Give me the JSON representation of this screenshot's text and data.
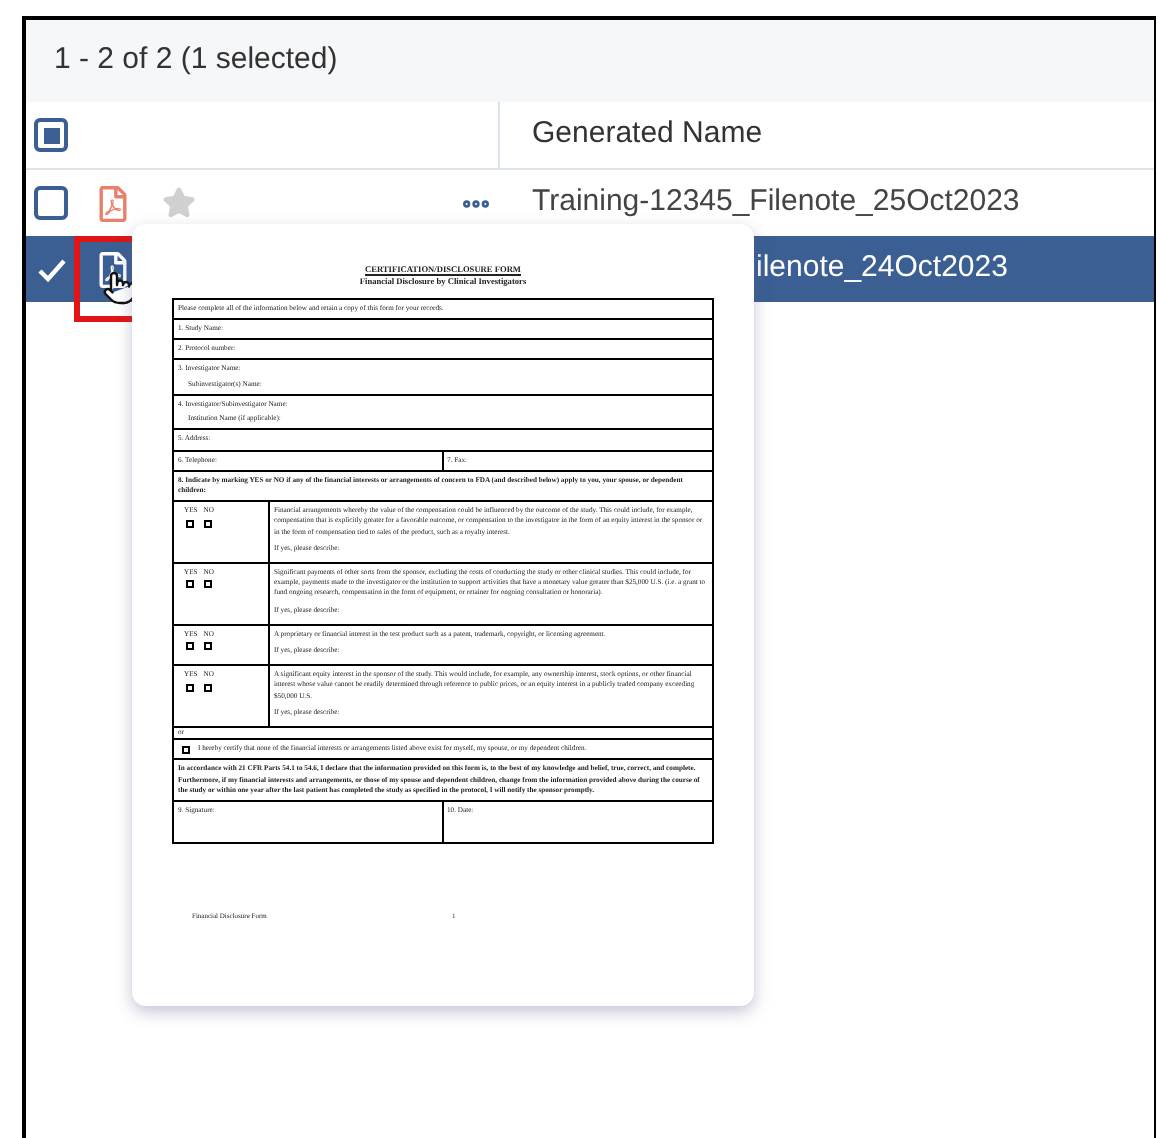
{
  "toolbar": {
    "count": "1 - 2 of 2 (1 selected)"
  },
  "table": {
    "header_checkbox": {
      "indeterminate": true
    },
    "columns": [
      "Generated Name"
    ],
    "rows": [
      {
        "selected": false,
        "checked": false,
        "starred": false,
        "hovered": false,
        "name": "Training-12345_Filenote_25Oct2023"
      },
      {
        "selected": true,
        "checked": true,
        "hovered": true,
        "name": "ilenote_24Oct2023"
      }
    ]
  },
  "preview": {
    "title": "CERTIFICATION/DISCLOSURE FORM",
    "subtitle": "Financial Disclosure by Clinical Investigators",
    "sections": [
      {
        "kind": "text",
        "texts": [
          "Please complete all of the information below and retain a copy of this form for your records."
        ]
      },
      {
        "kind": "text",
        "texts": [
          "1. Study Name:"
        ]
      },
      {
        "kind": "text",
        "texts": [
          "2. Protocol number:"
        ]
      },
      {
        "kind": "pair",
        "texts": [
          "3.  Investigator Name:",
          "Subinvestigator(s) Name:"
        ]
      },
      {
        "kind": "pair",
        "texts": [
          "4.  Investigator/Subinvestigator Name:",
          "Institution Name (if applicable):"
        ]
      },
      {
        "kind": "text",
        "texts": [
          "5. Address:"
        ]
      },
      {
        "kind": "split",
        "texts": [
          "6. Telephone:",
          "7. Fax:"
        ]
      },
      {
        "kind": "question",
        "texts": [
          "8.  Indicate by marking YES or NO if any of the financial interests or arrangements of concern to FDA (and described below) apply to you, your  spouse, or dependent children:"
        ]
      },
      {
        "kind": "interest",
        "options": [
          {
            "label": "YES",
            "checked": false
          },
          {
            "label": "NO",
            "checked": false
          }
        ],
        "texts": [
          "Financial arrangements whereby the value of the compensation could be influenced by the outcome of the study.  This could include, for example, compensation that is explicitly greater for a favorable outcome, or compensation to the investigator in the form of an equity interest in the sponsor or in the form of compensation tied to sales of the product, such as a royalty interest.",
          "If yes, please describe:"
        ]
      },
      {
        "kind": "interest",
        "options": [
          {
            "label": "YES",
            "checked": false
          },
          {
            "label": "NO",
            "checked": false
          }
        ],
        "texts": [
          "Significant payments of other sorts from the sponsor, excluding the costs of conducting the study or other clinical studies.  This could include, for example, payments made to the investigator or the institution to support activities that have a monetary value greater than $25,000 U.S. (i.e. a grant to fund ongoing research, compensation in the form of equipment, or retainer for ongoing consultation or honoraria).",
          "If yes, please describe:"
        ]
      },
      {
        "kind": "interest",
        "options": [
          {
            "label": "YES",
            "checked": false
          },
          {
            "label": "NO",
            "checked": false
          }
        ],
        "texts": [
          "A proprietary or financial interest in the test product such as a patent, trademark, copyright, or licensing agreement.",
          "If yes, please describe:"
        ]
      },
      {
        "kind": "interest",
        "options": [
          {
            "label": "YES",
            "checked": false
          },
          {
            "label": "NO",
            "checked": false
          }
        ],
        "texts": [
          "A significant equity interest in the sponsor of the study.  This would include, for example, any ownership interest, stock options, or other financial interest whose value cannot be readily determined through reference to public prices, or an equity interest in a publicly traded company exceeding $50,000 U.S.",
          "If yes, please describe:"
        ]
      },
      {
        "kind": "or",
        "texts": [
          "or"
        ]
      },
      {
        "kind": "certify",
        "checked": false,
        "texts": [
          "I hereby certify that none of the financial interests or arrangements listed above exist for myself, my spouse, or my dependent children."
        ]
      },
      {
        "kind": "declaration",
        "texts": [
          "In accordance with 21 CFR Parts 54.1 to 54.6, I declare that the information provided on this form is, to the best of my knowledge and belief, true, correct, and complete.  Furthermore, if my financial interests and arrangements, or those of my spouse and dependent children, change from the information provided above during the course of the study or within one year after the last patient has completed the study as specified in the protocol, I will notify the sponsor promptly."
        ]
      },
      {
        "kind": "signature",
        "texts": [
          "9.  Signature:",
          "10.  Date:"
        ]
      }
    ],
    "footer": {
      "label": "Financial Disclosure Form",
      "page": "1"
    }
  }
}
